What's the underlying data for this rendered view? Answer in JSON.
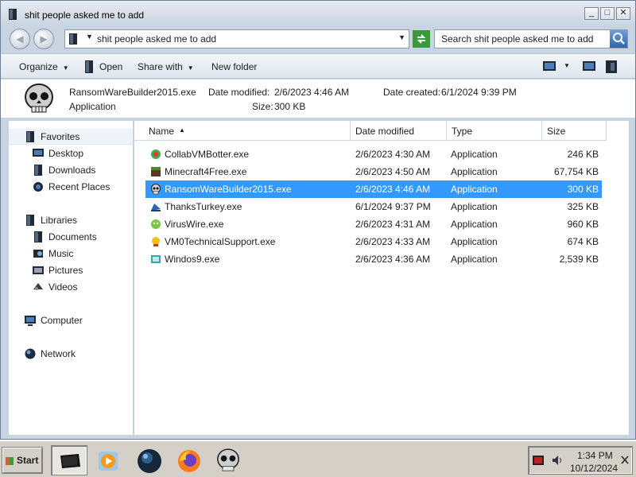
{
  "window": {
    "title": "shit people asked me to add",
    "buttons": [
      "_",
      "□",
      "✕"
    ]
  },
  "address": {
    "path": "shit people asked me to add",
    "search_placeholder": "Search shit people asked me to add"
  },
  "toolbar": {
    "organize": "Organize",
    "open": "Open",
    "share_with": "Share with",
    "new_folder": "New folder"
  },
  "details": {
    "name": "RansomWareBuilder2015.exe",
    "type": "Application",
    "modified_label": "Date modified:",
    "modified_value": "2/6/2023 4:46 AM",
    "created_label": "Date created:",
    "created_value": "6/1/2024 9:39 PM",
    "size_label": "Size:",
    "size_value": "300 KB"
  },
  "sidebar": {
    "favorites": "Favorites",
    "desktop": "Desktop",
    "downloads": "Downloads",
    "recent": "Recent Places",
    "libraries": "Libraries",
    "documents": "Documents",
    "music": "Music",
    "pictures": "Pictures",
    "videos": "Videos",
    "computer": "Computer",
    "network": "Network"
  },
  "columns": {
    "name": "Name",
    "modified": "Date modified",
    "type": "Type",
    "size": "Size"
  },
  "files": [
    {
      "name": "CollabVMBotter.exe",
      "modified": "2/6/2023 4:30 AM",
      "type": "Application",
      "size": "246 KB"
    },
    {
      "name": "Minecraft4Free.exe",
      "modified": "2/6/2023 4:50 AM",
      "type": "Application",
      "size": "67,754 KB"
    },
    {
      "name": "RansomWareBuilder2015.exe",
      "modified": "2/6/2023 4:46 AM",
      "type": "Application",
      "size": "300 KB"
    },
    {
      "name": "ThanksTurkey.exe",
      "modified": "6/1/2024 9:37 PM",
      "type": "Application",
      "size": "325 KB"
    },
    {
      "name": "VirusWire.exe",
      "modified": "2/6/2023 4:31 AM",
      "type": "Application",
      "size": "960 KB"
    },
    {
      "name": "VM0TechnicalSupport.exe",
      "modified": "2/6/2023 4:33 AM",
      "type": "Application",
      "size": "674 KB"
    },
    {
      "name": "Windos9.exe",
      "modified": "2/6/2023 4:36 AM",
      "type": "Application",
      "size": "2,539 KB"
    }
  ],
  "taskbar": {
    "start": "Start",
    "time": "1:34 PM",
    "date": "10/12/2024"
  }
}
